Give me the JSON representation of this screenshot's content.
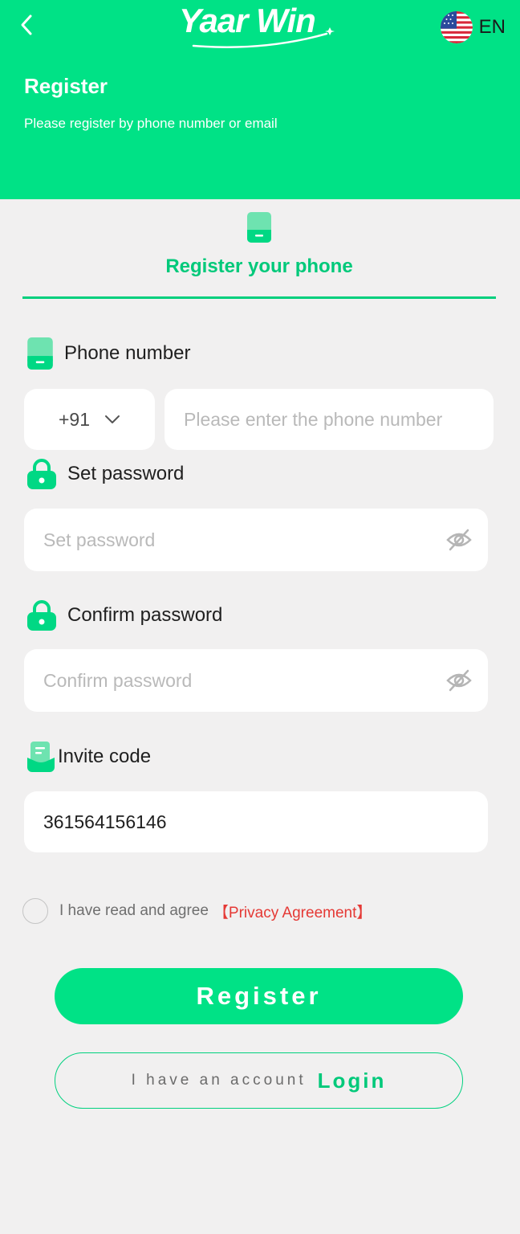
{
  "header": {
    "logo_text": "Yaar Win",
    "language": "EN",
    "title": "Register",
    "subtitle": "Please register by phone number or email"
  },
  "tab": {
    "label": "Register your phone"
  },
  "form": {
    "phone": {
      "label": "Phone number",
      "country_code": "+91",
      "placeholder": "Please enter the phone number"
    },
    "password": {
      "label": "Set password",
      "placeholder": "Set password"
    },
    "confirm": {
      "label": "Confirm password",
      "placeholder": "Confirm password"
    },
    "invite": {
      "label": "Invite code",
      "value": "361564156146"
    }
  },
  "agreement": {
    "text": "I have read and agree",
    "link": "【Privacy Agreement】"
  },
  "buttons": {
    "register": "Register",
    "login_prefix": "I have an account",
    "login": "Login"
  },
  "colors": {
    "brand": "#00e286",
    "brand_text": "#00c97a",
    "link_red": "#e53935",
    "background": "#f1f0f0"
  },
  "icons": {
    "back": "chevron-left-icon",
    "flag": "us-flag-icon",
    "phone": "phone-icon",
    "lock": "lock-icon",
    "invite": "invite-icon",
    "eye": "eye-off-icon",
    "dropdown": "chevron-down-icon"
  }
}
